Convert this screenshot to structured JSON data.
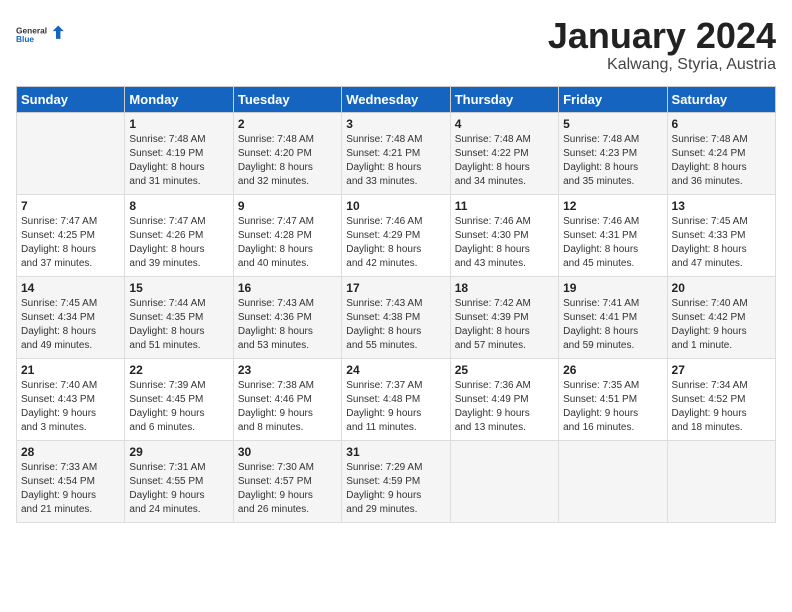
{
  "header": {
    "logo_general": "General",
    "logo_blue": "Blue",
    "title": "January 2024",
    "subtitle": "Kalwang, Styria, Austria"
  },
  "weekdays": [
    "Sunday",
    "Monday",
    "Tuesday",
    "Wednesday",
    "Thursday",
    "Friday",
    "Saturday"
  ],
  "weeks": [
    [
      {
        "day": "",
        "info": ""
      },
      {
        "day": "1",
        "info": "Sunrise: 7:48 AM\nSunset: 4:19 PM\nDaylight: 8 hours\nand 31 minutes."
      },
      {
        "day": "2",
        "info": "Sunrise: 7:48 AM\nSunset: 4:20 PM\nDaylight: 8 hours\nand 32 minutes."
      },
      {
        "day": "3",
        "info": "Sunrise: 7:48 AM\nSunset: 4:21 PM\nDaylight: 8 hours\nand 33 minutes."
      },
      {
        "day": "4",
        "info": "Sunrise: 7:48 AM\nSunset: 4:22 PM\nDaylight: 8 hours\nand 34 minutes."
      },
      {
        "day": "5",
        "info": "Sunrise: 7:48 AM\nSunset: 4:23 PM\nDaylight: 8 hours\nand 35 minutes."
      },
      {
        "day": "6",
        "info": "Sunrise: 7:48 AM\nSunset: 4:24 PM\nDaylight: 8 hours\nand 36 minutes."
      }
    ],
    [
      {
        "day": "7",
        "info": "Sunrise: 7:47 AM\nSunset: 4:25 PM\nDaylight: 8 hours\nand 37 minutes."
      },
      {
        "day": "8",
        "info": "Sunrise: 7:47 AM\nSunset: 4:26 PM\nDaylight: 8 hours\nand 39 minutes."
      },
      {
        "day": "9",
        "info": "Sunrise: 7:47 AM\nSunset: 4:28 PM\nDaylight: 8 hours\nand 40 minutes."
      },
      {
        "day": "10",
        "info": "Sunrise: 7:46 AM\nSunset: 4:29 PM\nDaylight: 8 hours\nand 42 minutes."
      },
      {
        "day": "11",
        "info": "Sunrise: 7:46 AM\nSunset: 4:30 PM\nDaylight: 8 hours\nand 43 minutes."
      },
      {
        "day": "12",
        "info": "Sunrise: 7:46 AM\nSunset: 4:31 PM\nDaylight: 8 hours\nand 45 minutes."
      },
      {
        "day": "13",
        "info": "Sunrise: 7:45 AM\nSunset: 4:33 PM\nDaylight: 8 hours\nand 47 minutes."
      }
    ],
    [
      {
        "day": "14",
        "info": "Sunrise: 7:45 AM\nSunset: 4:34 PM\nDaylight: 8 hours\nand 49 minutes."
      },
      {
        "day": "15",
        "info": "Sunrise: 7:44 AM\nSunset: 4:35 PM\nDaylight: 8 hours\nand 51 minutes."
      },
      {
        "day": "16",
        "info": "Sunrise: 7:43 AM\nSunset: 4:36 PM\nDaylight: 8 hours\nand 53 minutes."
      },
      {
        "day": "17",
        "info": "Sunrise: 7:43 AM\nSunset: 4:38 PM\nDaylight: 8 hours\nand 55 minutes."
      },
      {
        "day": "18",
        "info": "Sunrise: 7:42 AM\nSunset: 4:39 PM\nDaylight: 8 hours\nand 57 minutes."
      },
      {
        "day": "19",
        "info": "Sunrise: 7:41 AM\nSunset: 4:41 PM\nDaylight: 8 hours\nand 59 minutes."
      },
      {
        "day": "20",
        "info": "Sunrise: 7:40 AM\nSunset: 4:42 PM\nDaylight: 9 hours\nand 1 minute."
      }
    ],
    [
      {
        "day": "21",
        "info": "Sunrise: 7:40 AM\nSunset: 4:43 PM\nDaylight: 9 hours\nand 3 minutes."
      },
      {
        "day": "22",
        "info": "Sunrise: 7:39 AM\nSunset: 4:45 PM\nDaylight: 9 hours\nand 6 minutes."
      },
      {
        "day": "23",
        "info": "Sunrise: 7:38 AM\nSunset: 4:46 PM\nDaylight: 9 hours\nand 8 minutes."
      },
      {
        "day": "24",
        "info": "Sunrise: 7:37 AM\nSunset: 4:48 PM\nDaylight: 9 hours\nand 11 minutes."
      },
      {
        "day": "25",
        "info": "Sunrise: 7:36 AM\nSunset: 4:49 PM\nDaylight: 9 hours\nand 13 minutes."
      },
      {
        "day": "26",
        "info": "Sunrise: 7:35 AM\nSunset: 4:51 PM\nDaylight: 9 hours\nand 16 minutes."
      },
      {
        "day": "27",
        "info": "Sunrise: 7:34 AM\nSunset: 4:52 PM\nDaylight: 9 hours\nand 18 minutes."
      }
    ],
    [
      {
        "day": "28",
        "info": "Sunrise: 7:33 AM\nSunset: 4:54 PM\nDaylight: 9 hours\nand 21 minutes."
      },
      {
        "day": "29",
        "info": "Sunrise: 7:31 AM\nSunset: 4:55 PM\nDaylight: 9 hours\nand 24 minutes."
      },
      {
        "day": "30",
        "info": "Sunrise: 7:30 AM\nSunset: 4:57 PM\nDaylight: 9 hours\nand 26 minutes."
      },
      {
        "day": "31",
        "info": "Sunrise: 7:29 AM\nSunset: 4:59 PM\nDaylight: 9 hours\nand 29 minutes."
      },
      {
        "day": "",
        "info": ""
      },
      {
        "day": "",
        "info": ""
      },
      {
        "day": "",
        "info": ""
      }
    ]
  ]
}
